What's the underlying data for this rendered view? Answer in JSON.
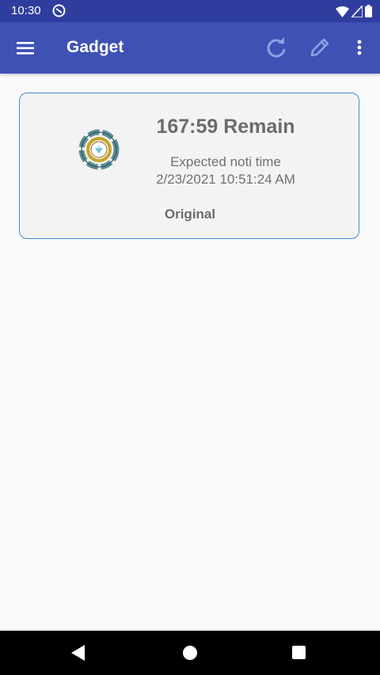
{
  "status_bar": {
    "time": "10:30",
    "icons": [
      "notification-icon",
      "wifi-icon",
      "cellular-signal-icon",
      "battery-icon"
    ]
  },
  "app_bar": {
    "title": "Gadget",
    "icons": [
      "menu-icon",
      "refresh-icon",
      "edit-icon",
      "more-vert-icon"
    ],
    "color": "#3f51b5"
  },
  "card": {
    "remain": "167:59 Remain",
    "expected_label": "Expected noti time",
    "expected_value": "2/23/2021 10:51:24 AM",
    "variant": "Original",
    "icon": "gadget-icon",
    "border_color": "#4a86d8"
  },
  "nav_bar": {
    "icons": [
      "back-icon",
      "home-icon",
      "recents-icon"
    ]
  }
}
